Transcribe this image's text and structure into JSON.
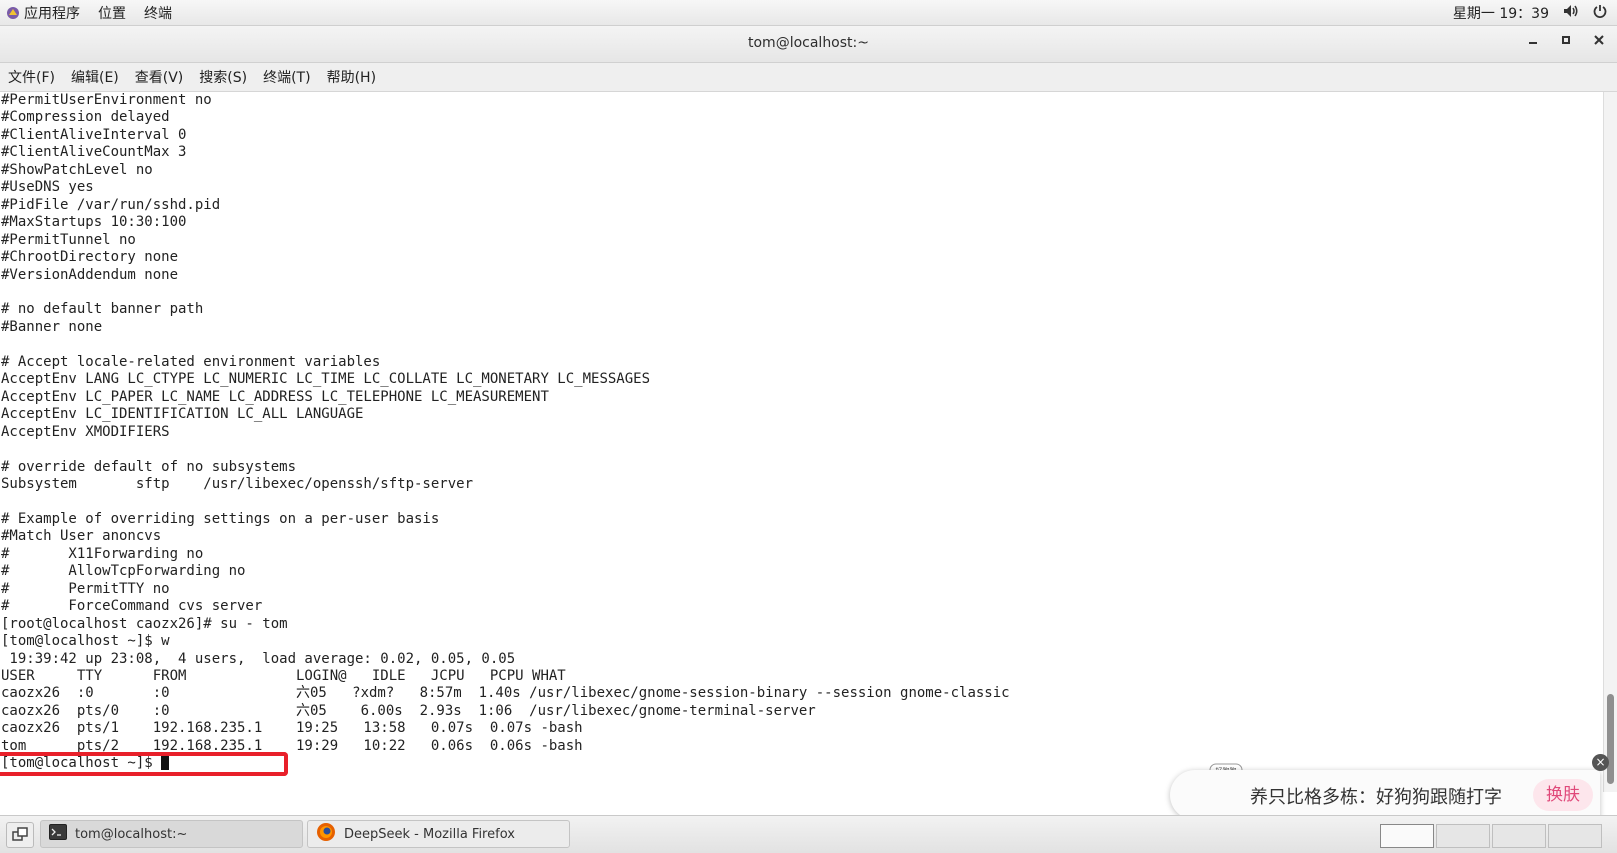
{
  "topbar": {
    "applications": "应用程序",
    "places": "位置",
    "terminal": "终端",
    "clock": "星期一 19：39"
  },
  "window": {
    "title": "tom@localhost:~"
  },
  "menubar": {
    "items": [
      "文件(F)",
      "编辑(E)",
      "查看(V)",
      "搜索(S)",
      "终端(T)",
      "帮助(H)"
    ]
  },
  "terminal": {
    "lines": [
      "#PermitUserEnvironment no",
      "#Compression delayed",
      "#ClientAliveInterval 0",
      "#ClientAliveCountMax 3",
      "#ShowPatchLevel no",
      "#UseDNS yes",
      "#PidFile /var/run/sshd.pid",
      "#MaxStartups 10:30:100",
      "#PermitTunnel no",
      "#ChrootDirectory none",
      "#VersionAddendum none",
      "",
      "# no default banner path",
      "#Banner none",
      "",
      "# Accept locale-related environment variables",
      "AcceptEnv LANG LC_CTYPE LC_NUMERIC LC_TIME LC_COLLATE LC_MONETARY LC_MESSAGES",
      "AcceptEnv LC_PAPER LC_NAME LC_ADDRESS LC_TELEPHONE LC_MEASUREMENT",
      "AcceptEnv LC_IDENTIFICATION LC_ALL LANGUAGE",
      "AcceptEnv XMODIFIERS",
      "",
      "# override default of no subsystems",
      "Subsystem       sftp    /usr/libexec/openssh/sftp-server",
      "",
      "# Example of overriding settings on a per-user basis",
      "#Match User anoncvs",
      "#       X11Forwarding no",
      "#       AllowTcpForwarding no",
      "#       PermitTTY no",
      "#       ForceCommand cvs server",
      "[root@localhost caozx26]# su - tom",
      "[tom@localhost ~]$ w",
      " 19:39:42 up 23:08,  4 users,  load average: 0.02, 0.05, 0.05",
      "USER     TTY      FROM             LOGIN@   IDLE   JCPU   PCPU WHAT",
      "caozx26  :0       :0               六05   ?xdm?   8:57m  1.40s /usr/libexec/gnome-session-binary --session gnome-classic",
      "caozx26  pts/0    :0               六05    6.00s  2.93s  1:06  /usr/libexec/gnome-terminal-server",
      "caozx26  pts/1    192.168.235.1    19:25   13:58   0.07s  0.07s -bash",
      "tom      pts/2    192.168.235.1    19:29   10:22   0.06s  0.06s -bash"
    ],
    "prompt": "[tom@localhost ~]$ "
  },
  "popup": {
    "badge": "好狗狗",
    "text": "养只比格多栋：好狗狗跟随打字",
    "button": "换肤",
    "close": "×"
  },
  "taskbar": {
    "tasks": [
      {
        "label": "tom@localhost:~"
      },
      {
        "label": "DeepSeek - Mozilla Firefox"
      }
    ]
  },
  "colors": {
    "highlight": "#e8202a",
    "popup_button_text": "#e0497a"
  },
  "icons": [
    "applications-icon",
    "volume-icon",
    "power-icon",
    "minimize-icon",
    "maximize-icon",
    "close-icon",
    "terminal-app-icon",
    "firefox-icon",
    "show-desktop-icon",
    "mascot-icon"
  ]
}
